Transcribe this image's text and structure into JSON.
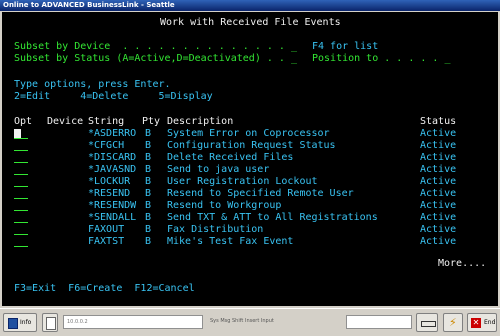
{
  "window": {
    "title": "Online to ADVANCED BusinessLink - Seattle"
  },
  "screen": {
    "heading": "Work with Received File Events",
    "subset_device": "Subset by Device  . . . . . . . . . . . . . . _",
    "f4_hint": "F4 for list",
    "subset_status": "Subset by Status (A=Active,D=Deactivated) . . _",
    "position_to": "Position to . . . . . _",
    "type_options": "Type options, press Enter.",
    "options_line": "2=Edit     4=Delete     5=Display",
    "columns": {
      "opt": "Opt",
      "device": "Device",
      "string": "String",
      "pty": "Pty",
      "description": "Description",
      "status": "Status"
    },
    "rows": [
      {
        "string": "*ASDERRO",
        "pty": "B",
        "description": "System Error on Coprocessor",
        "status": "Active"
      },
      {
        "string": "*CFGCH",
        "pty": "B",
        "description": "Configuration Request Status",
        "status": "Active"
      },
      {
        "string": "*DISCARD",
        "pty": "B",
        "description": "Delete Received Files",
        "status": "Active"
      },
      {
        "string": "*JAVASND",
        "pty": "B",
        "description": "Send to java user",
        "status": "Active"
      },
      {
        "string": "*LOCKUR",
        "pty": "B",
        "description": "User Registration Lockout",
        "status": "Active"
      },
      {
        "string": "*RESEND",
        "pty": "B",
        "description": "Resend to Specified Remote User",
        "status": "Active"
      },
      {
        "string": "*RESENDW",
        "pty": "B",
        "description": "Resend to Workgroup",
        "status": "Active"
      },
      {
        "string": "*SENDALL",
        "pty": "B",
        "description": "Send TXT & ATT to All Registrations",
        "status": "Active"
      },
      {
        "string": "FAXOUT",
        "pty": "B",
        "description": "Fax Distribution",
        "status": "Active"
      },
      {
        "string": "FAXTST",
        "pty": "B",
        "description": "Mike's Test Fax Event",
        "status": "Active"
      }
    ],
    "more": "More....",
    "function_keys": "F3=Exit  F6=Create  F12=Cancel"
  },
  "statusbar": {
    "info_label": "Info",
    "session_field": "10.0.0.2",
    "indicators": "Sys  Msg  Shift  Insert  Input",
    "end_label": "End"
  }
}
